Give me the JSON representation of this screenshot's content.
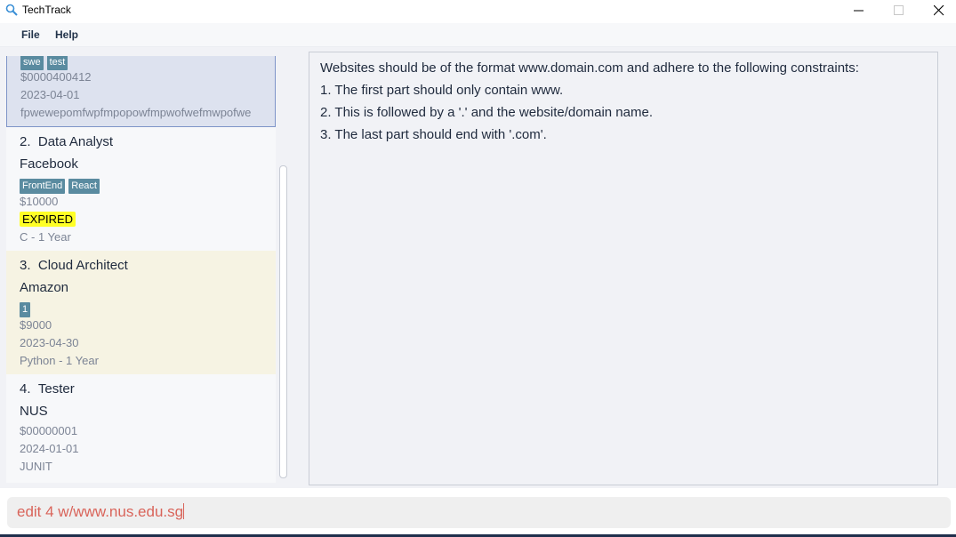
{
  "window": {
    "title": "TechTrack",
    "icon": "magnifier-icon",
    "controls": [
      "minimize-icon",
      "maximize-icon",
      "close-icon"
    ]
  },
  "menu": {
    "file": "File",
    "help": "Help"
  },
  "jobs": [
    {
      "tags": [
        "swe",
        "test"
      ],
      "salary": "$0000400412",
      "deadline": "2023-04-01",
      "extra": "fpwewepomfwpfmpopowfmpwofwefmwpofwe"
    },
    {
      "index": "2.",
      "title": "Data Analyst",
      "company": "Facebook",
      "tags": [
        "FrontEnd",
        "React"
      ],
      "salary": "$10000",
      "status": "EXPIRED",
      "experience": "C - 1 Year"
    },
    {
      "index": "3.",
      "title": "Cloud Architect",
      "company": "Amazon",
      "tags": [
        "1"
      ],
      "salary": "$9000",
      "deadline": "2023-04-30",
      "experience": "Python - 1 Year"
    },
    {
      "index": "4.",
      "title": "Tester",
      "company": "NUS",
      "salary": "$00000001",
      "deadline": "2024-01-01",
      "experience": "JUNIT"
    }
  ],
  "result": {
    "lines": [
      "Websites should be of the format www.domain.com and adhere to the following constraints:",
      "1. The first part should only contain www.",
      "2. This is followed by a '.' and the website/domain name.",
      "3. The last part should end with '.com'."
    ]
  },
  "command": {
    "value": "edit 4 w/www.nus.edu.sg"
  },
  "colors": {
    "tag": "#5a8ba0",
    "expired": "#ffff26",
    "command_text": "#d9645a",
    "selected_card": "#dde2ef"
  }
}
